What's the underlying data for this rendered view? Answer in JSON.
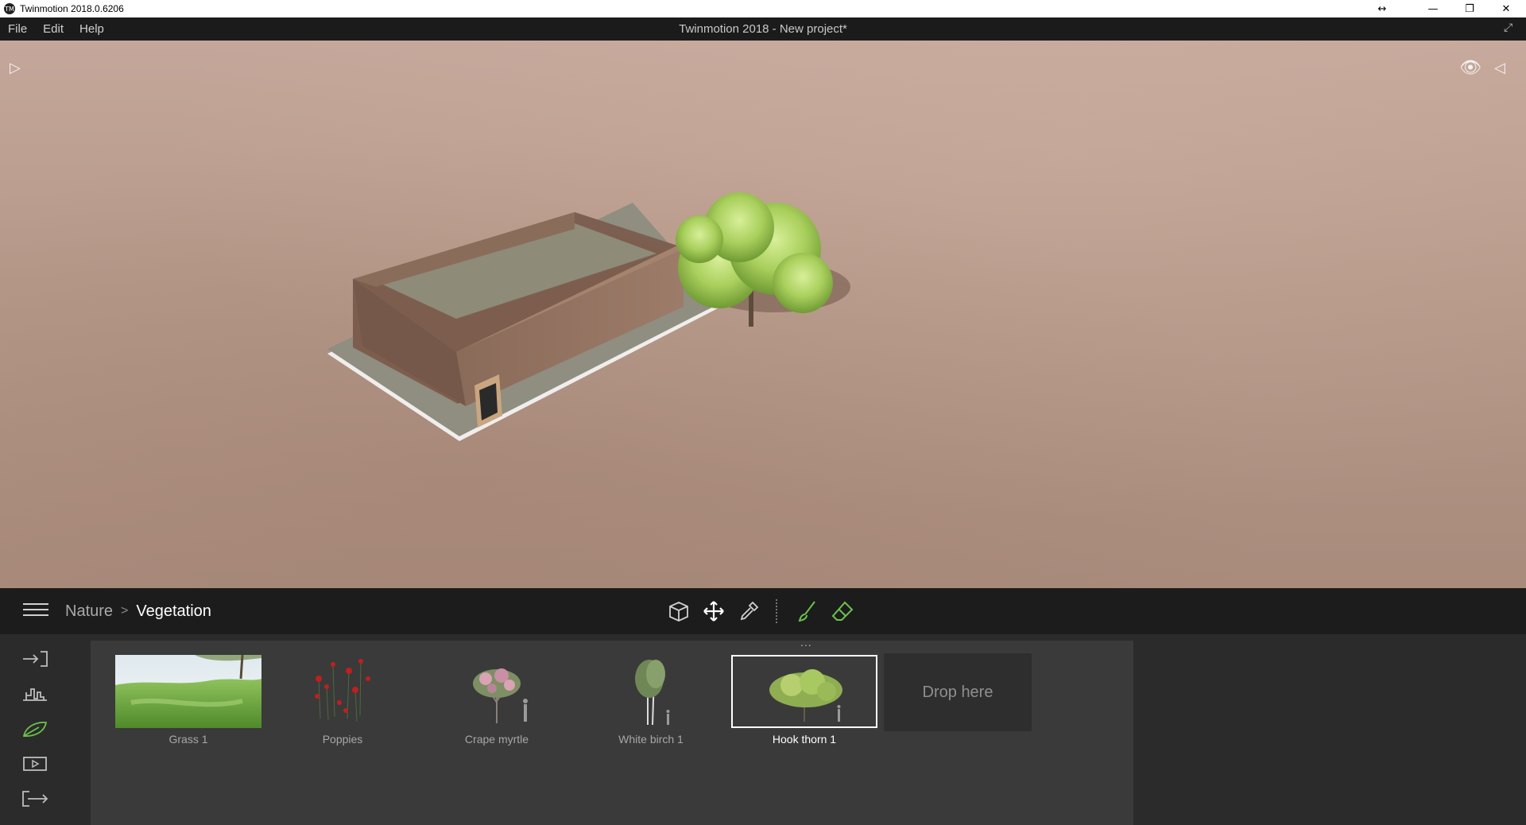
{
  "window": {
    "app_title": "Twinmotion 2018.0.6206",
    "controls": {
      "resize": "↔",
      "minimize": "—",
      "restore": "❐",
      "close": "✕"
    }
  },
  "menubar": {
    "items": [
      "File",
      "Edit",
      "Help"
    ],
    "document_title": "Twinmotion 2018 - New project*"
  },
  "breadcrumb": {
    "parent": "Nature",
    "separator": ">",
    "current": "Vegetation"
  },
  "tools": [
    "cube-icon",
    "move-icon",
    "eyedropper-icon",
    "brush-icon",
    "eraser-icon"
  ],
  "sidebar": [
    "import-icon",
    "settings-icon",
    "vegetation-leaf-icon",
    "media-icon",
    "export-icon"
  ],
  "library": {
    "more": "...",
    "assets": [
      {
        "label": "Grass 1"
      },
      {
        "label": "Poppies"
      },
      {
        "label": "Crape myrtle"
      },
      {
        "label": "White birch 1"
      },
      {
        "label": "Hook thorn 1",
        "selected": true
      }
    ],
    "drop_zone": "Drop here"
  },
  "colors": {
    "accent": "#6cc24a",
    "ground": "#b8998a",
    "panel": "#3a3a3a",
    "bar": "#1c1c1c"
  }
}
